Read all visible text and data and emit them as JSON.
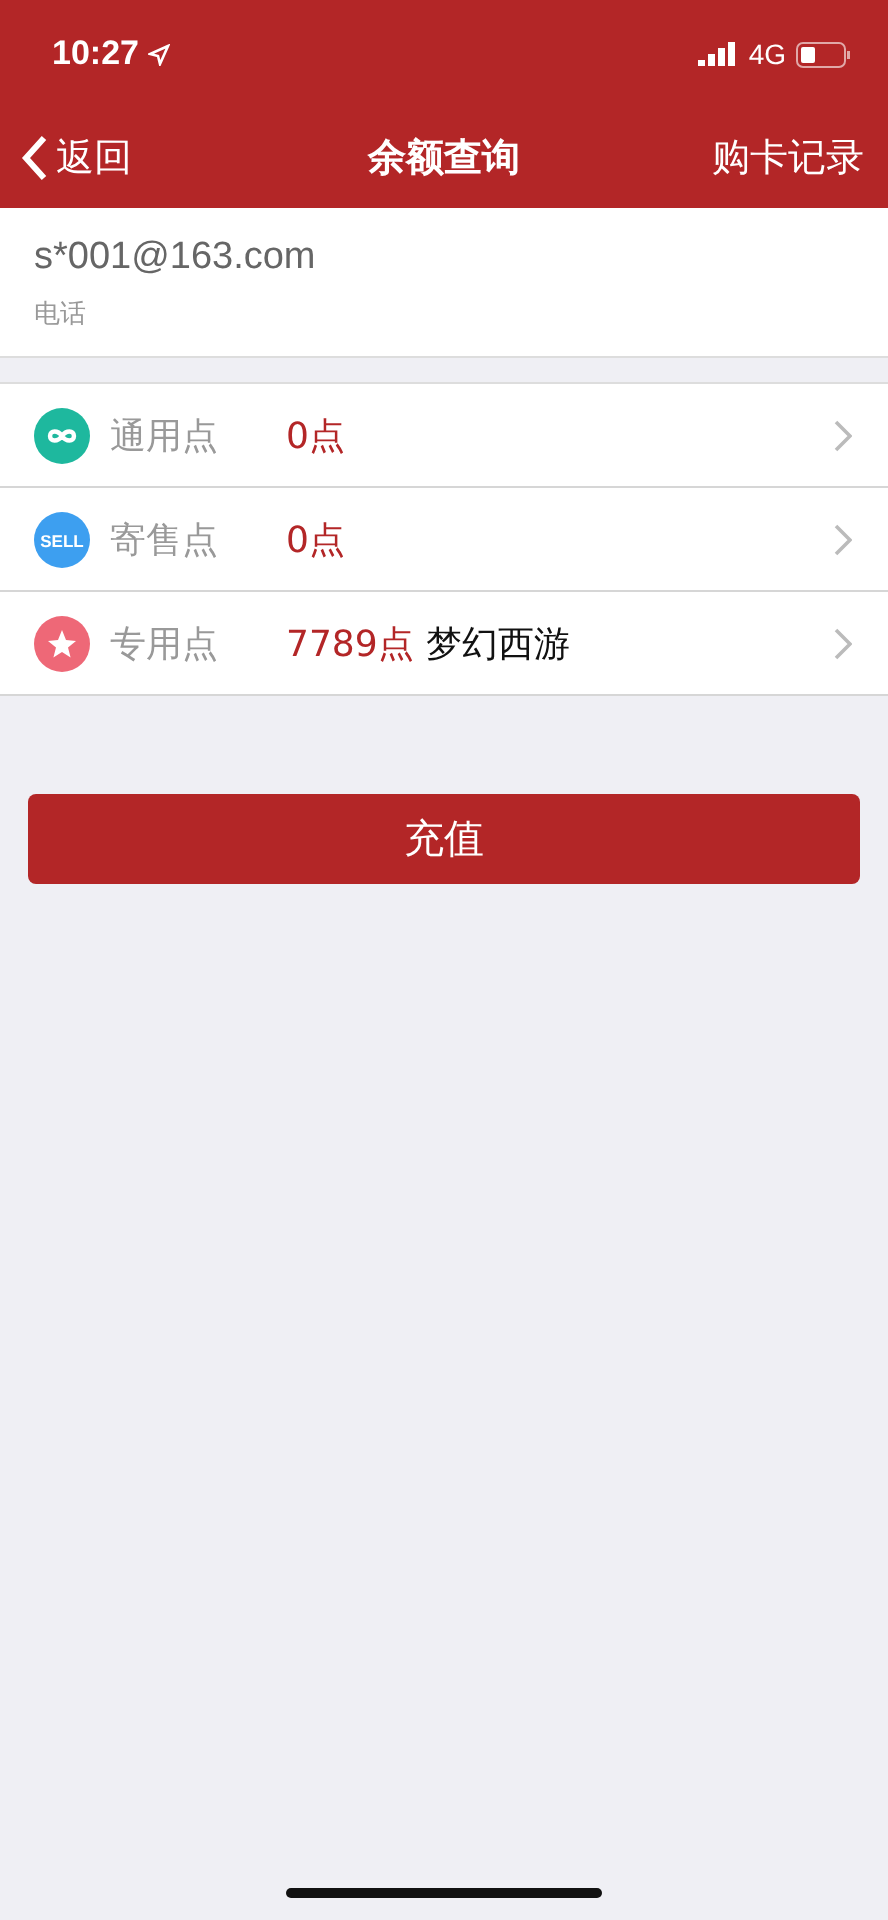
{
  "status_bar": {
    "time": "10:27",
    "network": "4G"
  },
  "nav": {
    "back": "返回",
    "title": "余额查询",
    "action": "购卡记录"
  },
  "account": {
    "name": "s*001@163.com",
    "note": "电话"
  },
  "balances": [
    {
      "kind": "infinity",
      "color": "#1eb89e",
      "label": "通用点",
      "amount": "0点"
    },
    {
      "kind": "sell",
      "color": "#3d9ff0",
      "icon_text": "SELL",
      "label": "寄售点",
      "amount": "0点"
    },
    {
      "kind": "star",
      "color": "#ee6877",
      "label": "专用点",
      "amount": "7789点",
      "game": "梦幻西游"
    }
  ],
  "button": "充值"
}
